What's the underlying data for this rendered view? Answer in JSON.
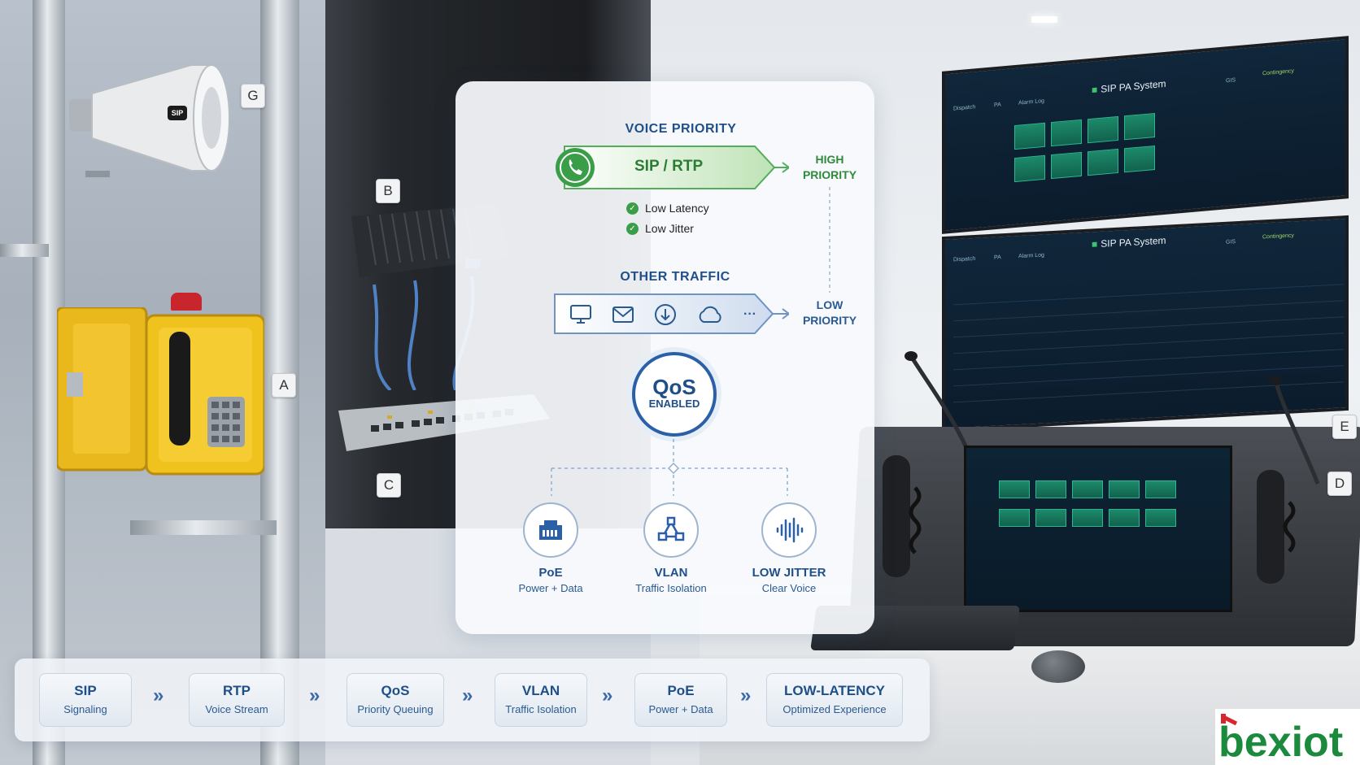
{
  "markers": {
    "a": "A",
    "b": "B",
    "c": "C",
    "d": "D",
    "e": "E",
    "g": "G"
  },
  "horn_badge": "SIP",
  "screens": {
    "top_title": "SIP PA System",
    "bottom_title": "SIP PA System",
    "top_nav": [
      "Dispatch",
      "PA",
      "Alarm Log"
    ],
    "bottom_nav": [
      "Dispatch",
      "PA",
      "Alarm Log"
    ],
    "top_right_tabs": [
      "GIS",
      "Contingency"
    ],
    "bottom_right_tabs": [
      "GIS",
      "Contingency"
    ]
  },
  "qos": {
    "voice_title": "VOICE PRIORITY",
    "sip_label": "SIP / RTP",
    "high_priority": [
      "HIGH",
      "PRIORITY"
    ],
    "checks": [
      "Low Latency",
      "Low Jitter"
    ],
    "other_title": "OTHER TRAFFIC",
    "other_ellipsis": "···",
    "low_priority": [
      "LOW",
      "PRIORITY"
    ],
    "circle_main": "QoS",
    "circle_sub": "ENABLED",
    "features": [
      {
        "title": "PoE",
        "sub": "Power + Data",
        "icon": "ethernet-port-icon"
      },
      {
        "title": "VLAN",
        "sub": "Traffic Isolation",
        "icon": "network-topology-icon"
      },
      {
        "title": "LOW JITTER",
        "sub": "Clear Voice",
        "icon": "audio-wave-icon"
      }
    ]
  },
  "pipeline": [
    {
      "title": "SIP",
      "sub": "Signaling"
    },
    {
      "title": "RTP",
      "sub": "Voice Stream"
    },
    {
      "title": "QoS",
      "sub": "Priority Queuing"
    },
    {
      "title": "VLAN",
      "sub": "Traffic Isolation"
    },
    {
      "title": "PoE",
      "sub": "Power + Data"
    },
    {
      "title": "LOW-LATENCY",
      "sub": "Optimized Experience"
    }
  ],
  "pipeline_separator": "»",
  "logo_text": "bexiot",
  "colors": {
    "voice_green": "#3a9e48",
    "primary_blue": "#1f4f8a",
    "logo_red": "#d8262c",
    "logo_green": "#1c8a3c"
  }
}
